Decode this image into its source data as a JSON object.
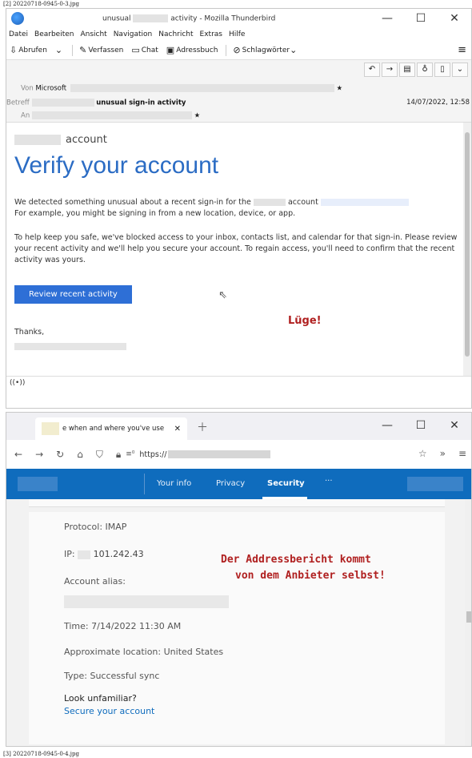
{
  "captions": {
    "top": "[2] 20220718-0945-0-3.jpg",
    "bottom": "[3] 20220718-0945-0-4.jpg"
  },
  "thunderbird": {
    "title_prefix": "unusual",
    "title_suffix": "activity - Mozilla Thunderbird",
    "window_controls": [
      "—",
      "☐",
      "✕"
    ],
    "menu": [
      "Datei",
      "Bearbeiten",
      "Ansicht",
      "Navigation",
      "Nachricht",
      "Extras",
      "Hilfe"
    ],
    "toolbar": {
      "get_mail": "Abrufen",
      "compose": "Verfassen",
      "chat": "Chat",
      "address_book": "Adressbuch",
      "tags": "Schlagwörter"
    },
    "header": {
      "from_label": "Von",
      "from_value": "Microsoft",
      "subject_label": "Betreff",
      "subject_value": "unusual sign-in activity",
      "to_label": "An",
      "date": "14/07/2022, 12:58"
    },
    "body": {
      "account_word": "account",
      "title": "Verify your account",
      "para1_a": "We detected something unusual about a recent sign-in for the",
      "para1_b": "account",
      "para1_c": "For example, you might be signing in from a new location, device, or app.",
      "para2": "To help keep you safe, we've blocked access to your inbox, contacts list, and calendar for that sign-in. Please review your recent activity and we'll help you secure your account. To regain access, you'll need to confirm that the recent activity was yours.",
      "button": "Review recent activity",
      "annotation": "Lüge!",
      "thanks": "Thanks,"
    }
  },
  "firefox": {
    "tab_title": "e when and where you've use",
    "url_prefix": "https://",
    "ms_nav": [
      "Your info",
      "Privacy",
      "Security",
      "···"
    ],
    "fields": {
      "protocol": "Protocol: IMAP",
      "ip_label": "IP:",
      "ip_value": "101.242.43",
      "alias_label": "Account alias:",
      "time": "Time: 7/14/2022 11:30 AM",
      "location": "Approximate location: United States",
      "type": "Type: Successful sync",
      "look": "Look unfamiliar?",
      "secure": "Secure your account"
    },
    "annotation_line1": "Der Addressbericht kommt",
    "annotation_line2": "von dem Anbieter selbst!"
  }
}
